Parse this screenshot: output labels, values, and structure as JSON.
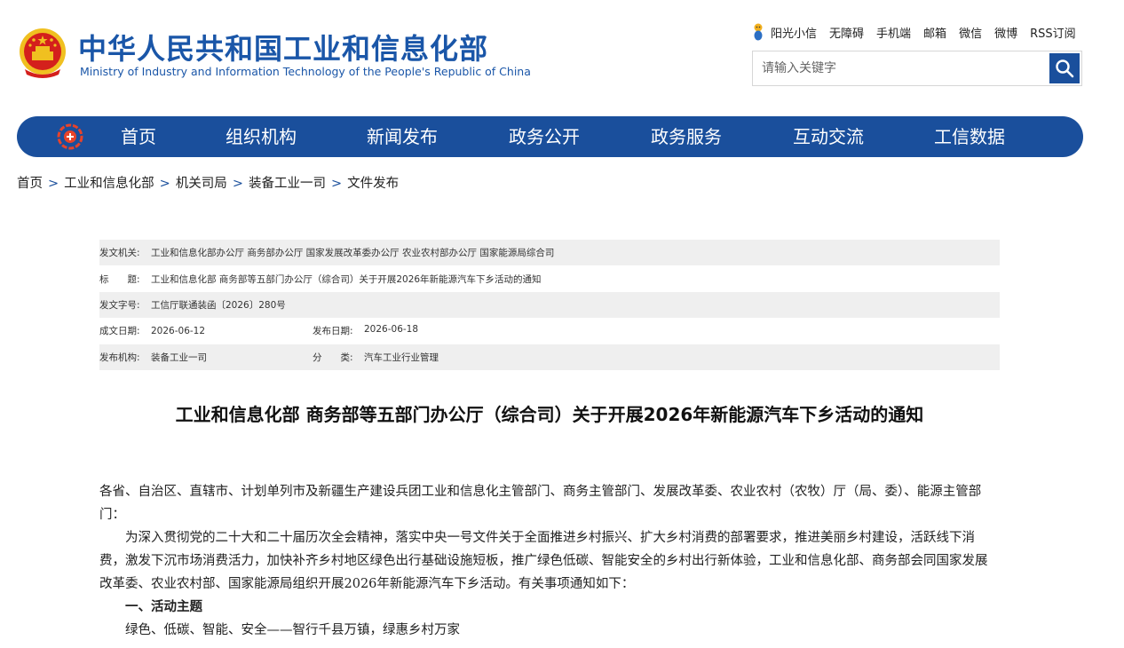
{
  "header": {
    "title_cn": "中华人民共和国工业和信息化部",
    "title_en": "Ministry of Industry and Information Technology of the People's Republic of China",
    "top_links": [
      "阳光小信",
      "无障碍",
      "手机端",
      "邮箱",
      "微信",
      "微博",
      "RSS订阅"
    ],
    "search_placeholder": "请输入关键字"
  },
  "nav": {
    "items": [
      "首页",
      "组织机构",
      "新闻发布",
      "政务公开",
      "政务服务",
      "互动交流",
      "工信数据"
    ]
  },
  "breadcrumb": [
    "首页",
    "工业和信息化部",
    "机关司局",
    "装备工业一司",
    "文件发布"
  ],
  "breadcrumb_sep": ">",
  "meta": {
    "issuer_label": "发文机关:",
    "issuer": "工业和信息化部办公厅 商务部办公厅 国家发展改革委办公厅 农业农村部办公厅 国家能源局综合司",
    "title_label": "标　　题:",
    "title": "工业和信息化部 商务部等五部门办公厅（综合司）关于开展2026年新能源汽车下乡活动的通知",
    "docno_label": "发文字号:",
    "docno": "工信厅联通装函〔2026〕280号",
    "created_label": "成文日期:",
    "created": "2026-06-12",
    "published_label": "发布日期:",
    "published": "2026-06-18",
    "org_label": "发布机构:",
    "org": "装备工业一司",
    "category_label": "分　　类:",
    "category": "汽车工业行业管理"
  },
  "document": {
    "title": "工业和信息化部 商务部等五部门办公厅（综合司）关于开展2026年新能源汽车下乡活动的通知",
    "salutation": "各省、自治区、直辖市、计划单列市及新疆生产建设兵团工业和信息化主管部门、商务主管部门、发展改革委、农业农村（农牧）厅（局、委）、能源主管部门：",
    "paragraph1": "为深入贯彻党的二十大和二十届历次全会精神，落实中央一号文件关于全面推进乡村振兴、扩大乡村消费的部署要求，推进美丽乡村建设，活跃线下消费，激发下沉市场消费活力，加快补齐乡村地区绿色出行基础设施短板，推广绿色低碳、智能安全的乡村出行新体验，工业和信息化部、商务部会同国家发展改革委、农业农村部、国家能源局组织开展2026年新能源汽车下乡活动。有关事项通知如下：",
    "section1_heading": "一、活动主题",
    "section1_text": "绿色、低碳、智能、安全——智行千县万镇，绿惠乡村万家"
  },
  "colors": {
    "brand_blue": "#1a4f9c",
    "title_blue": "#1a56a8",
    "meta_shade": "#efefef"
  },
  "icons": {
    "emblem": "national-emblem-icon",
    "sunshine": "sunshine-mascot-icon",
    "search": "search-icon",
    "nav_logo": "miit-logo-icon"
  }
}
